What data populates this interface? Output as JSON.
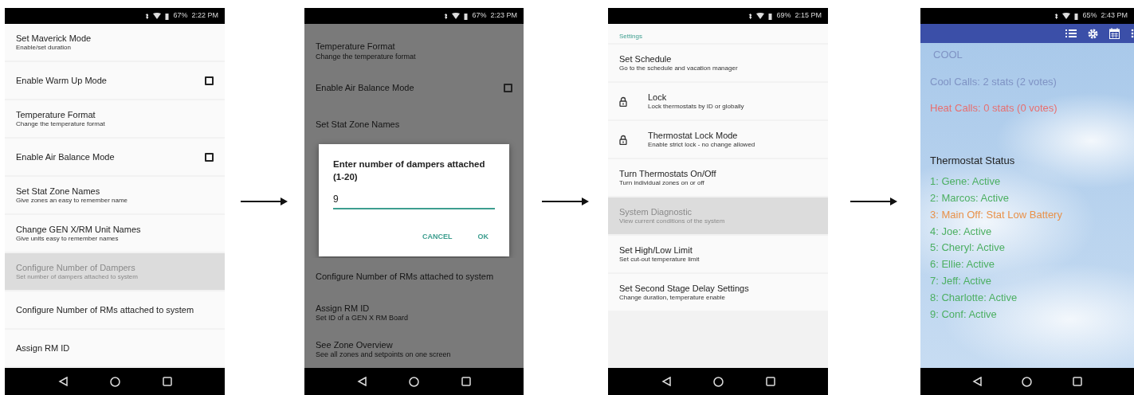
{
  "screens": [
    {
      "status_bar": {
        "battery": "67%",
        "time": "2:22 PM"
      },
      "items": [
        {
          "title": "Set Maverick Mode",
          "subtitle": "Enable/set duration",
          "kind": "text",
          "selected": false
        },
        {
          "title": "Enable Warm Up Mode",
          "kind": "checkbox",
          "checked": false,
          "selected": false
        },
        {
          "title": "Temperature Format",
          "subtitle": "Change the temperature format",
          "kind": "text",
          "selected": false
        },
        {
          "title": "Enable Air Balance Mode",
          "kind": "checkbox",
          "checked": false,
          "selected": false
        },
        {
          "title": "Set Stat Zone Names",
          "subtitle": "Give zones an easy to remember name",
          "kind": "text",
          "selected": false
        },
        {
          "title": "Change GEN X/RM Unit Names",
          "subtitle": "Give units easy to remember names",
          "kind": "text",
          "selected": false
        },
        {
          "title": "Configure Number of Dampers",
          "subtitle": "Set number of dampers attached to system",
          "kind": "text",
          "selected": true
        },
        {
          "title": "Configure Number of RMs attached to system",
          "kind": "text",
          "selected": false
        },
        {
          "title": "Assign RM ID",
          "kind": "text",
          "selected": false
        }
      ]
    },
    {
      "status_bar": {
        "battery": "67%",
        "time": "2:23 PM"
      },
      "items_above_dialog": [
        {
          "title": "Temperature Format",
          "subtitle": "Change the temperature format",
          "kind": "text"
        },
        {
          "title": "Enable Air Balance Mode",
          "kind": "checkbox",
          "checked": false
        },
        {
          "title": "Set Stat Zone Names",
          "kind": "text"
        }
      ],
      "dialog": {
        "title": "Enter number of dampers attached (1-20)",
        "value": "9",
        "buttons": [
          "CANCEL",
          "OK"
        ]
      },
      "items_below_dialog": [
        {
          "title": "Configure Number of RMs attached to system",
          "kind": "text"
        },
        {
          "title": "Assign RM ID",
          "subtitle": "Set ID of a GEN X RM Board",
          "kind": "text"
        },
        {
          "title": "See Zone Overview",
          "subtitle": "See all zones and setpoints on one screen",
          "kind": "text"
        }
      ]
    },
    {
      "status_bar": {
        "battery": "69%",
        "time": "2:15 PM"
      },
      "section_header": "Settings",
      "items": [
        {
          "title": "Set Schedule",
          "subtitle": "Go to the schedule and vacation manager",
          "kind": "text",
          "selected": false
        },
        {
          "title": "Lock",
          "subtitle": "Lock thermostats by ID or globally",
          "kind": "lock",
          "selected": false
        },
        {
          "title": "Thermostat Lock Mode",
          "subtitle": "Enable strict lock - no change allowed",
          "kind": "lock",
          "selected": false
        },
        {
          "title": "Turn Thermostats On/Off",
          "subtitle": "Turn individual zones on or off",
          "kind": "text",
          "selected": false
        },
        {
          "title": "System Diagnostic",
          "subtitle": "View current conditions of the system",
          "kind": "text",
          "selected": true
        },
        {
          "title": "Set High/Low Limit",
          "subtitle": "Set cut-out temperature limit",
          "kind": "text",
          "selected": false
        },
        {
          "title": "Set Second Stage Delay Settings",
          "subtitle": "Change duration, temperature enable",
          "kind": "text",
          "selected": false
        }
      ]
    },
    {
      "status_bar": {
        "battery": "65%",
        "time": "2:43 PM"
      },
      "mode": "COOL",
      "summary_lines": [
        {
          "text": "Cool Calls: 2 stats (2 votes)",
          "color": "#7f93c4"
        },
        {
          "text": "Heat Calls: 0 stats (0 votes)",
          "color": "#e86f6f"
        }
      ],
      "status_title": "Thermostat Status",
      "thermostats": [
        {
          "text": "1: Gene: Active",
          "color": "#4caf62"
        },
        {
          "text": "2: Marcos: Active",
          "color": "#4caf62"
        },
        {
          "text": "3: Main Off: Stat Low Battery",
          "color": "#e8914a"
        },
        {
          "text": "4: Joe: Active",
          "color": "#4caf62"
        },
        {
          "text": "5: Cheryl: Active",
          "color": "#4caf62"
        },
        {
          "text": "6: Ellie: Active",
          "color": "#4caf62"
        },
        {
          "text": "7: Jeff: Active",
          "color": "#4caf62"
        },
        {
          "text": "8: Charlotte: Active",
          "color": "#4caf62"
        },
        {
          "text": "9: Conf: Active",
          "color": "#4caf62"
        }
      ]
    }
  ]
}
